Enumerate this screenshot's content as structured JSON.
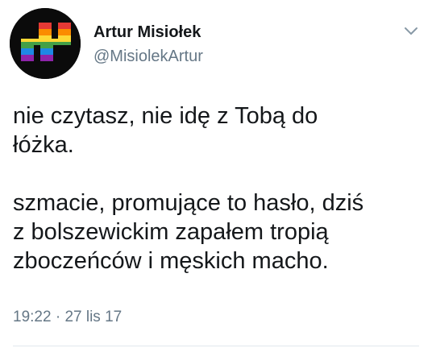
{
  "tweet": {
    "author": {
      "display_name": "Artur Misiołek",
      "handle": "@MisiolekArtur",
      "avatar_icon": "rainbow-swastika-avatar"
    },
    "menu_icon": "chevron-down-icon",
    "text": {
      "paragraph_1_line_1": "nie czytasz, nie idę z Tobą do",
      "paragraph_1_line_2": "łóżka.",
      "paragraph_2_line_1": "szmacie, promujące to hasło, dziś",
      "paragraph_2_line_2": "z bolszewickim zapałem tropią",
      "paragraph_2_line_3": "zboczeńców i męskich macho."
    },
    "meta": {
      "time": "19:22",
      "separator": "·",
      "date": "27 lis 17"
    },
    "colors": {
      "text": "#14171a",
      "secondary": "#657786",
      "divider": "#e1e8ed",
      "avatar_bg": "#000000"
    }
  }
}
